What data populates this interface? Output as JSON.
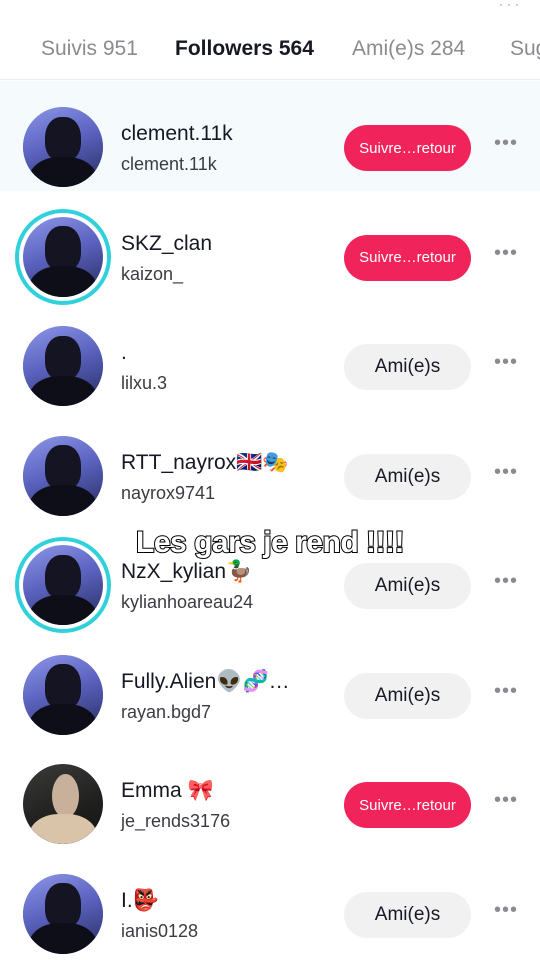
{
  "top_icon": "more-dots-icon",
  "tabs": [
    {
      "label": "Suivis 951"
    },
    {
      "label": "Followers 564"
    },
    {
      "label": "Ami(e)s 284"
    },
    {
      "label": "Sug"
    }
  ],
  "active_tab": 1,
  "rows": [
    {
      "display": "clement.11k",
      "username": "clement.11k",
      "button": "Suivre…retour",
      "button_type": "follow",
      "story": false
    },
    {
      "display": "SKZ_clan",
      "username": "kaizon_",
      "button": "Suivre…retour",
      "button_type": "follow",
      "story": true
    },
    {
      "display": ".",
      "username": "lilxu.3",
      "button": "Ami(e)s",
      "button_type": "friend",
      "story": false
    },
    {
      "display": "RTT_nayrox🇬🇧🎭",
      "username": "nayrox9741",
      "button": "Ami(e)s",
      "button_type": "friend",
      "story": false
    },
    {
      "display": "NzX_kylian🦆",
      "username": "kylianhoareau24",
      "button": "Ami(e)s",
      "button_type": "friend",
      "story": true
    },
    {
      "display": "Fully.Alien👽🧬…",
      "username": "rayan.bgd7",
      "button": "Ami(e)s",
      "button_type": "friend",
      "story": false
    },
    {
      "display": "Emma 🎀",
      "username": "je_rends3176",
      "button": "Suivre…retour",
      "button_type": "follow",
      "story": false
    },
    {
      "display": "I.👺",
      "username": "ianis0128",
      "button": "Ami(e)s",
      "button_type": "friend",
      "story": false
    }
  ],
  "more_label": "•••",
  "caption": "Les gars je rend !!!!",
  "colors": {
    "follow_button": "#f0245a",
    "friend_button": "#f1f1f2",
    "story_ring": "#31d1db",
    "tab_active": "#161823",
    "tab_inactive": "#8a8b91"
  }
}
